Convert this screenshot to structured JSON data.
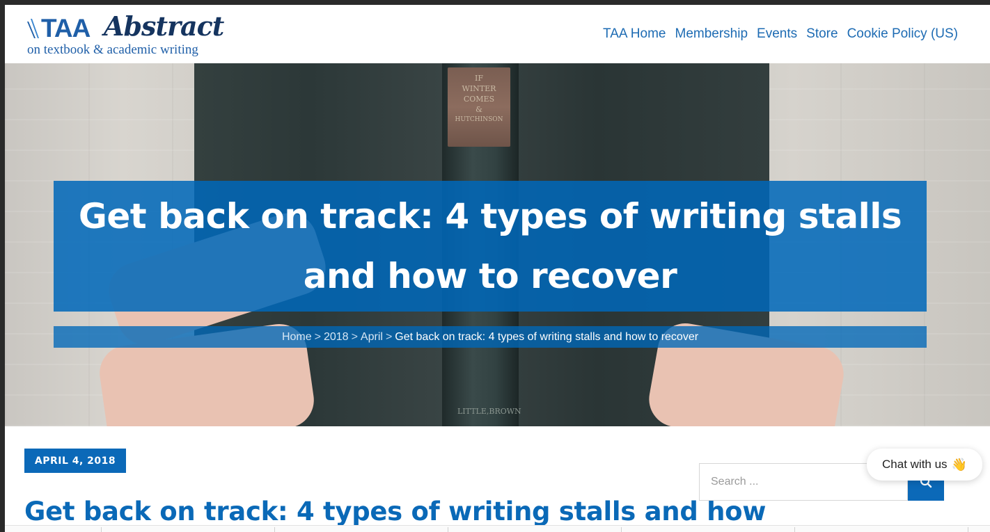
{
  "brand": {
    "logo_main": "TAA",
    "logo_script": "Abstract",
    "logo_subtitle": "on textbook & academic writing",
    "primary_color": "#0b69b8",
    "dark_color": "#15345f"
  },
  "nav": {
    "items": [
      {
        "label": "TAA Home"
      },
      {
        "label": "Membership"
      },
      {
        "label": "Events"
      },
      {
        "label": "Store"
      },
      {
        "label": "Cookie Policy (US)"
      }
    ]
  },
  "hero": {
    "book_spine_text": [
      "IF",
      "WINTER",
      "COMES",
      "&",
      "HUTCHINSON"
    ],
    "book_foot_text": "LITTLE,BROWN",
    "title": "Get back on track: 4 types of writing stalls and how to recover",
    "breadcrumb": {
      "home": "Home",
      "year": "2018",
      "month": "April",
      "separator": ">",
      "current": "Get back on track: 4 types of writing stalls and how to recover"
    }
  },
  "post": {
    "date": "APRIL 4, 2018",
    "title": "Get back on track: 4 types of writing stalls and how"
  },
  "sidebar": {
    "search_placeholder": "Search ...",
    "search_icon": "search-icon"
  },
  "chat": {
    "label": "Chat with us",
    "emoji": "👋"
  }
}
